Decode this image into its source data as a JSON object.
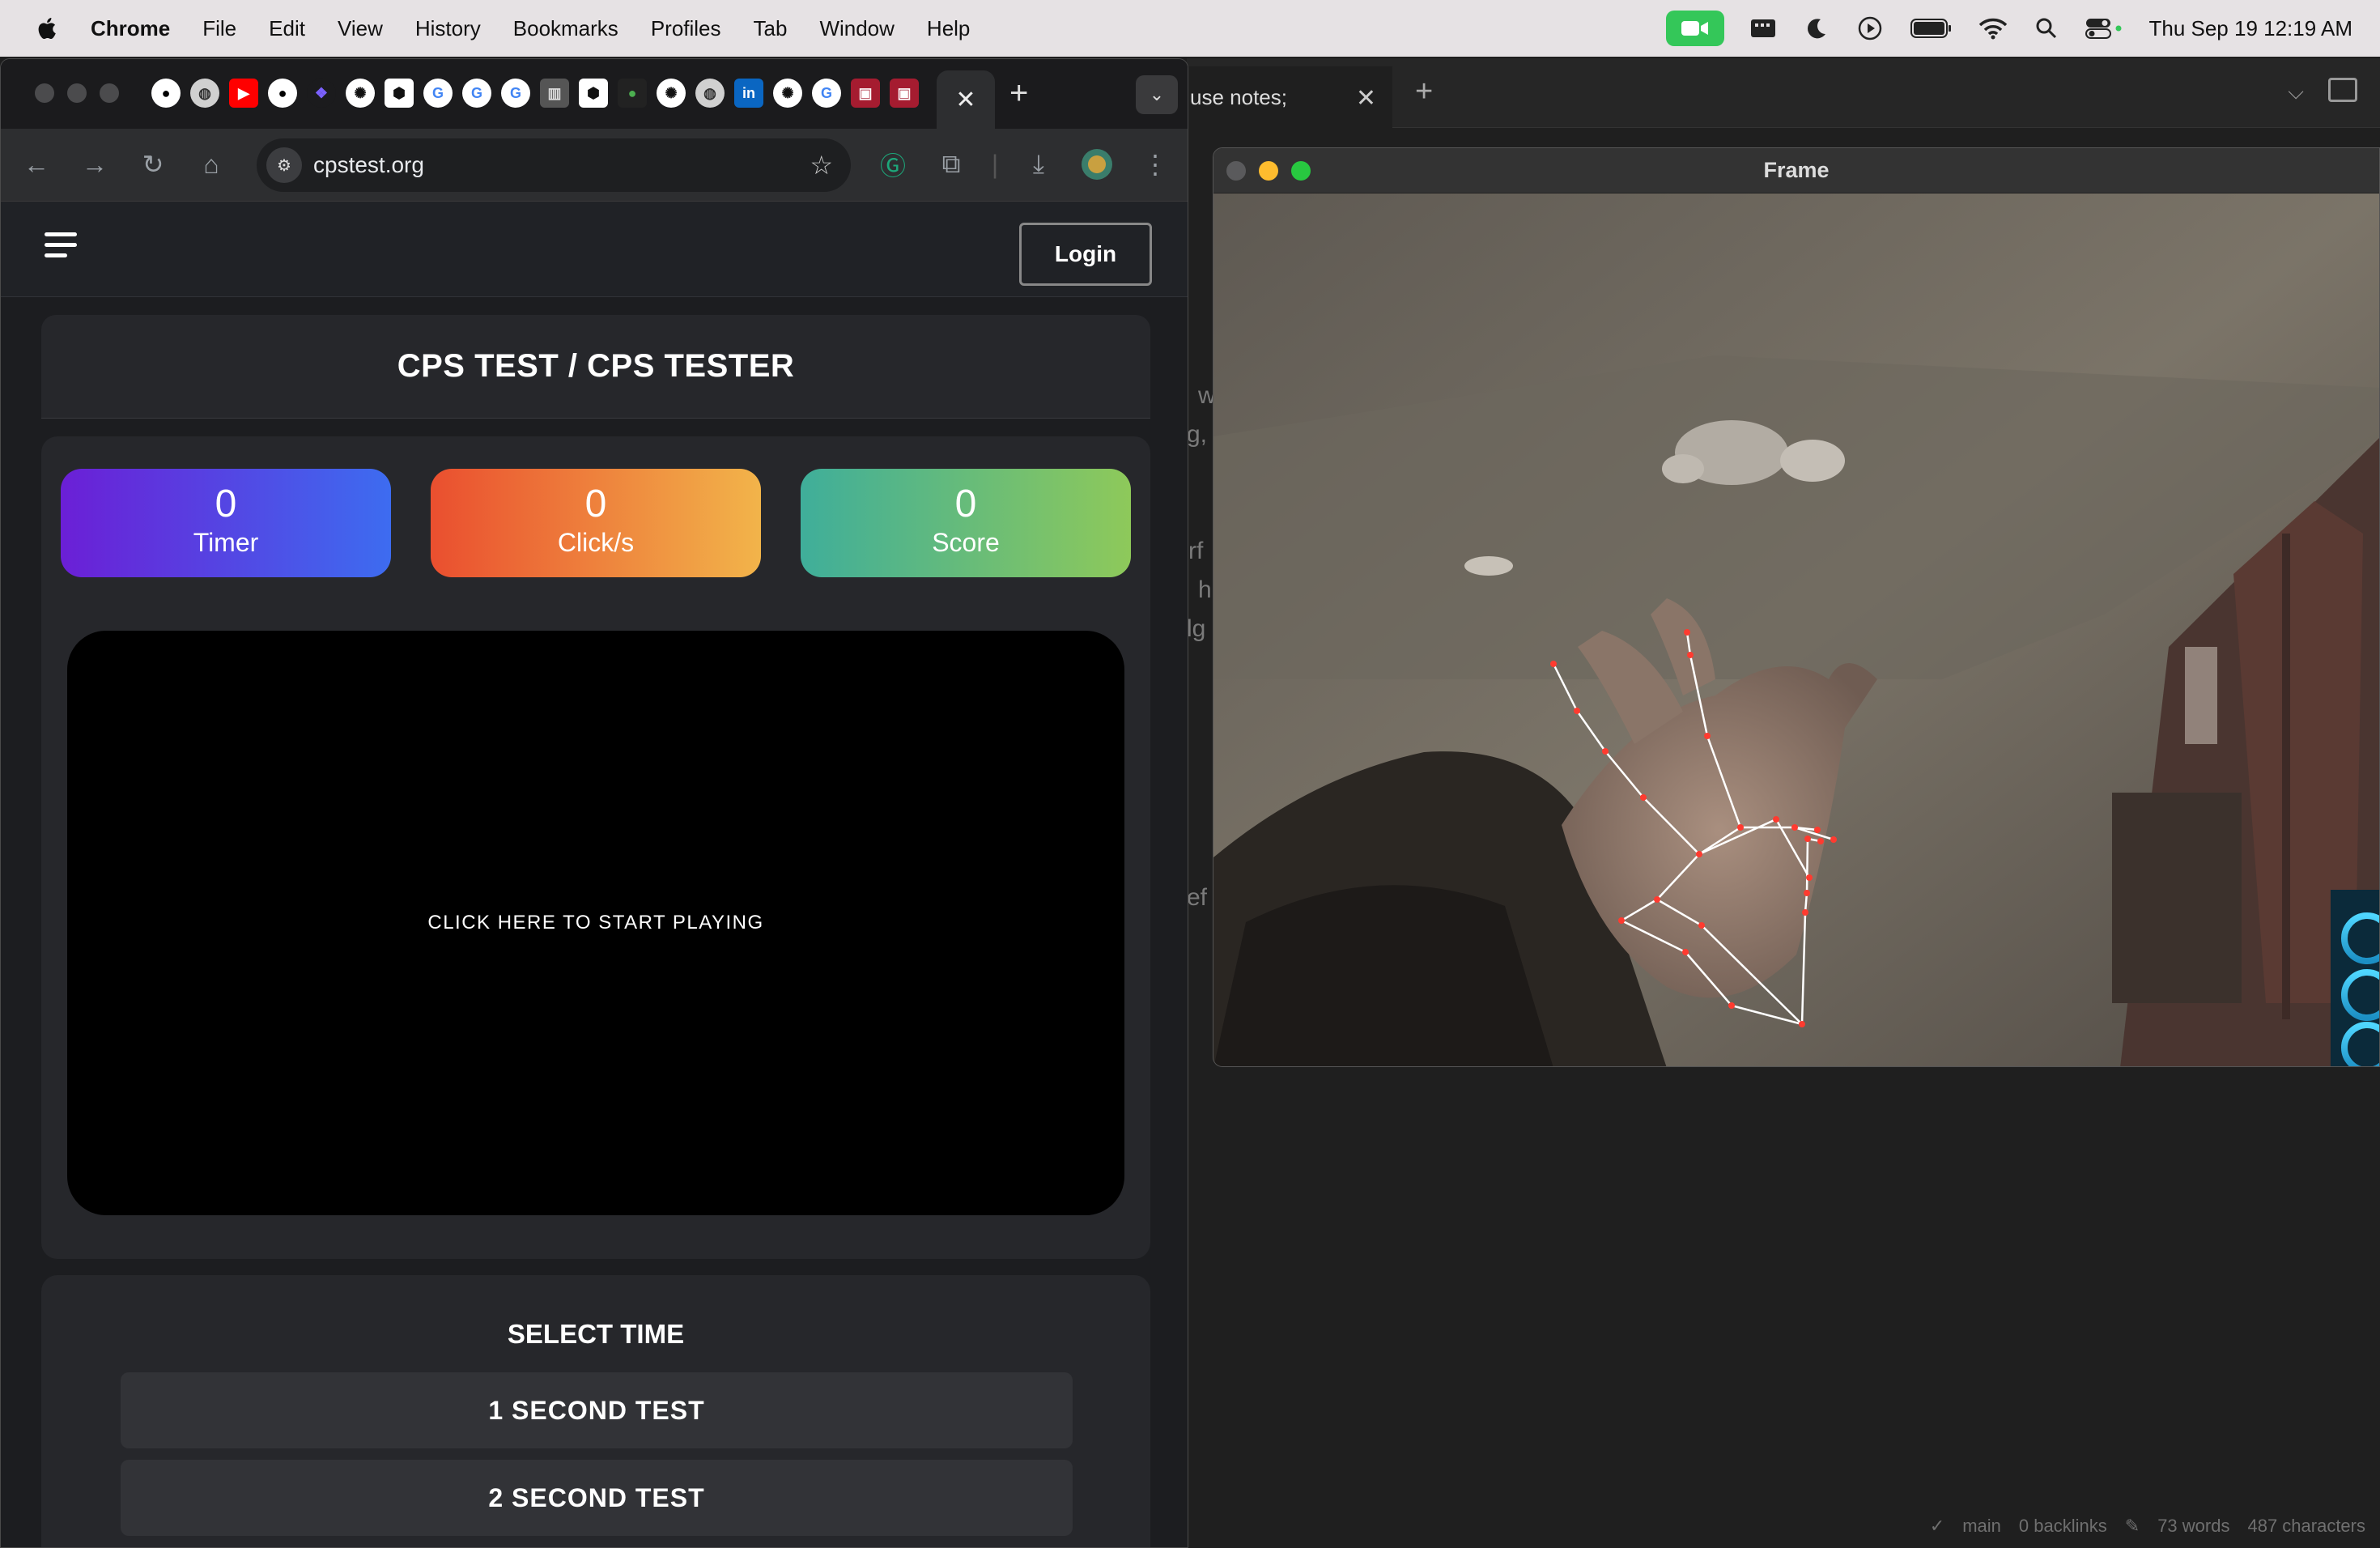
{
  "menubar": {
    "app_name": "Chrome",
    "items": [
      "File",
      "Edit",
      "View",
      "History",
      "Bookmarks",
      "Profiles",
      "Tab",
      "Window",
      "Help"
    ],
    "clock": "Thu Sep 19  12:19 AM"
  },
  "chrome": {
    "url": "cpstest.org",
    "close_tab": "✕",
    "new_tab": "+"
  },
  "site": {
    "login": "Login",
    "title": "CPS TEST / CPS TESTER",
    "stats": [
      {
        "value": "0",
        "label": "Timer"
      },
      {
        "value": "0",
        "label": "Click/s"
      },
      {
        "value": "0",
        "label": "Score"
      }
    ],
    "play_prompt": "CLICK HERE TO START PLAYING",
    "select_time": "SELECT TIME",
    "time_options": [
      "1 SECOND TEST",
      "2 SECOND TEST"
    ]
  },
  "frame_window": {
    "title": "Frame"
  },
  "notes_app": {
    "tab_title": "use notes;",
    "fragments": [
      "w",
      "g,",
      "rf",
      "h",
      "lg",
      "ef"
    ],
    "status": {
      "branch": "main",
      "backlinks": "0 backlinks",
      "words": "73 words",
      "characters": "487 characters"
    }
  },
  "colors": {
    "timer_gradient": [
      "#6b1fd6",
      "#3d6cf0"
    ],
    "clicks_gradient": [
      "#ea4f2f",
      "#f2b44a"
    ],
    "score_gradient": [
      "#3fae9a",
      "#8ec95a"
    ],
    "facetime_green": "#34c759",
    "landmark_red": "#ff3b30"
  }
}
